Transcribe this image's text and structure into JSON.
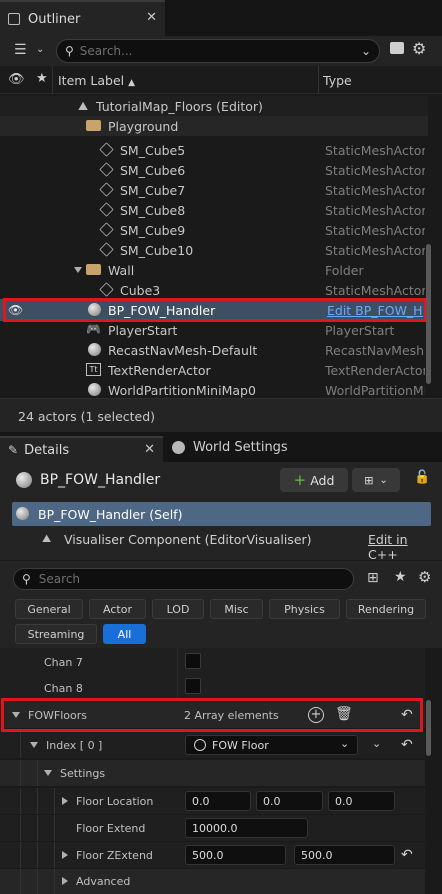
{
  "outliner": {
    "tab_label": "Outliner",
    "search_placeholder": "Search...",
    "col_label": "Item Label",
    "col_label_sort": "▲",
    "col_type": "Type",
    "rows": [
      {
        "name": "TutorialMap_Floors (Editor)",
        "type": ""
      },
      {
        "name": "Playground",
        "type": ""
      },
      {
        "name": "SM_Cube5",
        "type": "StaticMeshActor"
      },
      {
        "name": "SM_Cube6",
        "type": "StaticMeshActor"
      },
      {
        "name": "SM_Cube7",
        "type": "StaticMeshActor"
      },
      {
        "name": "SM_Cube8",
        "type": "StaticMeshActor"
      },
      {
        "name": "SM_Cube9",
        "type": "StaticMeshActor"
      },
      {
        "name": "SM_Cube10",
        "type": "StaticMeshActor"
      },
      {
        "name": "Wall",
        "type": "Folder"
      },
      {
        "name": "Cube3",
        "type": "StaticMeshActor"
      },
      {
        "name": "BP_FOW_Handler",
        "type": "Edit BP_FOW_Handler"
      },
      {
        "name": "PlayerStart",
        "type": "PlayerStart"
      },
      {
        "name": "RecastNavMesh-Default",
        "type": "RecastNavMesh"
      },
      {
        "name": "TextRenderActor",
        "type": "TextRenderActor"
      },
      {
        "name": "WorldPartitionMiniMap0",
        "type": "WorldPartitionMiniMap"
      }
    ],
    "status": "24 actors (1 selected)"
  },
  "details": {
    "tab_details": "Details",
    "tab_world": "World Settings",
    "actor_name": "BP_FOW_Handler",
    "add_label": "Add",
    "self_label": "BP_FOW_Handler (Self)",
    "component_label": "Visualiser Component (EditorVisualiser)",
    "edit_cpp": "Edit in C++",
    "search_placeholder": "Search",
    "filters": [
      "General",
      "Actor",
      "LOD",
      "Misc",
      "Physics",
      "Rendering",
      "Streaming",
      "All"
    ],
    "chan7": "Chan 7",
    "chan8": "Chan 8",
    "fowfloors": "FOWFloors",
    "array_elements": "2 Array elements",
    "index0": "Index [ 0 ]",
    "fow_floor": "FOW Floor",
    "settings": "Settings",
    "floor_location": "Floor Location",
    "loc_x": "0.0",
    "loc_y": "0.0",
    "loc_z": "0.0",
    "floor_extend": "Floor Extend",
    "extend_value": "10000.0",
    "floor_zextend": "Floor ZExtend",
    "zext_min": "500.0",
    "zext_max": "500.0",
    "advanced": "Advanced"
  },
  "colors": {
    "highlight": "#e0161e",
    "selection": "#3d4f63",
    "accent": "#1a6fd6"
  }
}
